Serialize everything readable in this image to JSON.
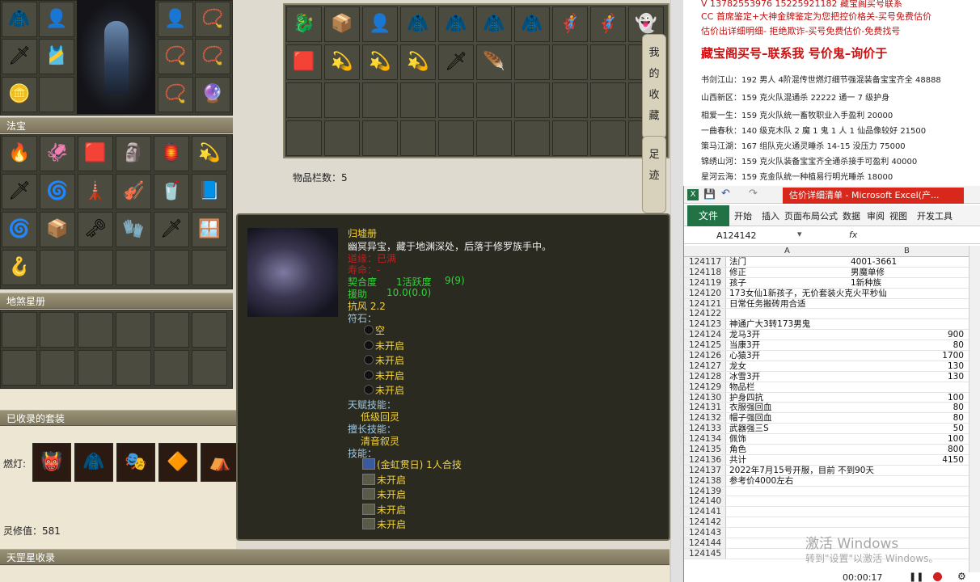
{
  "game": {
    "fabao_title": "法宝",
    "dishashu_title": "地煞星册",
    "collected_suits_title": "已收录的套装",
    "suit_label": "燃灯:",
    "linxiu_value": "灵修值：581",
    "tiangang_title": "天罡星收录",
    "item_slot_count": "物品栏数：5",
    "side_tabs": [
      "我",
      "的",
      "收",
      "藏"
    ],
    "side_tab2": [
      "足",
      "迹"
    ],
    "equip_icons": [
      "🧥",
      "🗡",
      "👤",
      "🎽",
      "⚔",
      "🪙",
      "📿",
      "🔮"
    ],
    "fabao_icons": [
      "🔥",
      "🦑",
      "🟥",
      "🗿",
      "🏮",
      "💫",
      "🗡",
      "🌀",
      "🗼",
      "🎻",
      "🥤",
      "📘",
      "🌀",
      "📦",
      "🗝",
      "🧤",
      "🗡",
      "🪟",
      "🪝"
    ],
    "suit_icons": [
      "👹",
      "🧥",
      "🎭",
      "🔶",
      "⛺"
    ],
    "bag_icons": [
      "🐉",
      "📦",
      "👤",
      "🧥",
      "🧥",
      "🧥",
      "🧥",
      "🦸",
      "🦸",
      "👻",
      "🟥",
      "💫",
      "💫",
      "💫",
      "🗡",
      "🪶"
    ]
  },
  "tooltip": {
    "name": "归墟册",
    "desc": "幽冥异宝，藏于地渊深处，后落于修罗族手中。",
    "red1": "道缘：已满",
    "red2": "寿命：-",
    "qihe": "契合度",
    "huoyue": "1活跃度",
    "huoyue_val": "9(9)",
    "yuanzhu": "援助",
    "yuanzhu_val": "10.0(0.0)",
    "kangfeng": "抗风 2.2",
    "fushi": "符石：",
    "fushi_slots": [
      "空",
      "未开启",
      "未开启",
      "未开启",
      "未开启"
    ],
    "tianfu_title": "天赋技能：",
    "tianfu": "低级回灵",
    "shanchang_title": "擅长技能：",
    "shanchang": "清音叙灵",
    "jineng_title": "技能：",
    "skills": [
      "(金虹贯日) 1人合技",
      "未开启",
      "未开启",
      "未开启",
      "未开启"
    ]
  },
  "doc": {
    "lines": [
      "V 13782553976   15225921182   藏宝阁买号联系",
      "CC 首席鉴定+大神金牌鉴定为您把控价格关-买号免费估价",
      "估价出详细明细- 拒绝欺诈-买号免费估价-免费找号",
      "藏宝阁买号–联系我 号价鬼–询价于",
      "书剑江山：192 男人 4阶混传世燃灯细节强混装备宝宝齐全 48888",
      "山西新区：159 克火队混通杀 22222 通一 7 级护身",
      "相爱一生：159 克火队统一畜牧职业入手盈利 20000",
      "一曲春秋：140 级克木队 2 魔 1 鬼 1 人 1 仙品像较好 21500",
      "策马江湖：167 组队克火通灵睡杀 14-15 没压力 75000",
      "锦绣山河：159 克火队装备宝宝齐全通杀接手可盈利 40000",
      "星河云海：159 克金队统一种植易行明光睡杀 18000"
    ]
  },
  "excel": {
    "title": "估价详细清单 - Microsoft Excel(产...",
    "file_tab": "文件",
    "tabs": [
      "开始",
      "插入",
      "页面布局",
      "公式",
      "数据",
      "审阅",
      "视图",
      "开发工具"
    ],
    "name_box": "A124142",
    "fx": "fx",
    "col_a": "A",
    "col_b": "B",
    "rows": [
      {
        "n": "124117",
        "a": "法门",
        "b": "4001-3661",
        "num": false
      },
      {
        "n": "124118",
        "a": "修正",
        "b": "男魔单修",
        "num": false
      },
      {
        "n": "124119",
        "a": "孩子",
        "b": "1新种族",
        "num": false
      },
      {
        "n": "124120",
        "a": "173女仙1新孩子，无价套装火克火平秒仙",
        "b": "",
        "num": false
      },
      {
        "n": "124121",
        "a": "日常任务搬砖用合适",
        "b": "",
        "num": false
      },
      {
        "n": "124122",
        "a": "",
        "b": "",
        "num": false
      },
      {
        "n": "124123",
        "a": "神通广大3转173男鬼",
        "b": "",
        "num": false
      },
      {
        "n": "124124",
        "a": "龙马3开",
        "b": "900",
        "num": true
      },
      {
        "n": "124125",
        "a": "当康3开",
        "b": "80",
        "num": true
      },
      {
        "n": "124126",
        "a": "心猿3开",
        "b": "1700",
        "num": true
      },
      {
        "n": "124127",
        "a": "龙女",
        "b": "130",
        "num": true
      },
      {
        "n": "124128",
        "a": "冰雪3开",
        "b": "130",
        "num": true
      },
      {
        "n": "124129",
        "a": "物品栏",
        "b": "",
        "num": false
      },
      {
        "n": "124130",
        "a": "护身四抗",
        "b": "100",
        "num": true
      },
      {
        "n": "124131",
        "a": "衣服强回血",
        "b": "80",
        "num": true
      },
      {
        "n": "124132",
        "a": "帽子强回血",
        "b": "80",
        "num": true
      },
      {
        "n": "124133",
        "a": "武器强三S",
        "b": "50",
        "num": true
      },
      {
        "n": "124134",
        "a": "佩饰",
        "b": "100",
        "num": true
      },
      {
        "n": "124135",
        "a": "角色",
        "b": "800",
        "num": true
      },
      {
        "n": "124136",
        "a": "共计",
        "b": "4150",
        "num": true
      },
      {
        "n": "124137",
        "a": "2022年7月15号开服，目前  不到90天",
        "b": "",
        "num": false
      },
      {
        "n": "124138",
        "a": "参考价4000左右",
        "b": "",
        "num": false
      },
      {
        "n": "124139",
        "a": "",
        "b": "",
        "num": false
      },
      {
        "n": "124140",
        "a": "",
        "b": "",
        "num": false
      },
      {
        "n": "124141",
        "a": "",
        "b": "",
        "num": false
      },
      {
        "n": "124142",
        "a": "",
        "b": "",
        "num": false
      },
      {
        "n": "124143",
        "a": "",
        "b": "",
        "num": false
      },
      {
        "n": "124144",
        "a": "",
        "b": "",
        "num": false
      },
      {
        "n": "124145",
        "a": "",
        "b": "",
        "num": false
      }
    ]
  },
  "overlay": {
    "activate1": "激活 Windows",
    "activate2": "转到\"设置\"以激活 Windows。",
    "timer": "00:00:17"
  }
}
